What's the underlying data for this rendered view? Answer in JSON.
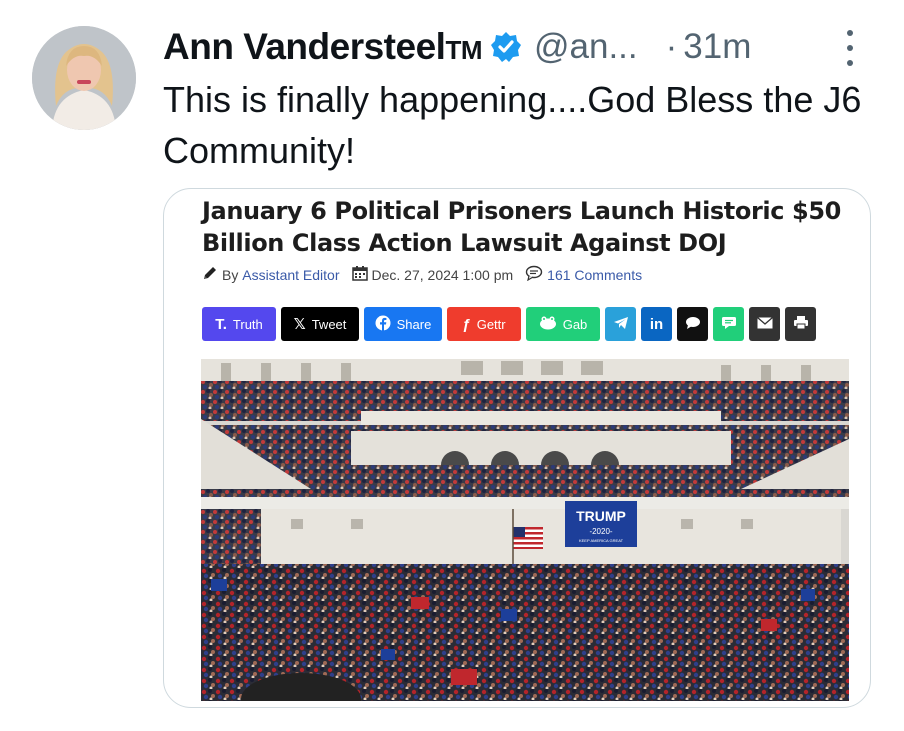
{
  "tweet": {
    "author_name": "Ann Vandersteel",
    "author_suffix": "TM",
    "handle": "@an...",
    "separator": "·",
    "time": "31m",
    "text": "This is finally happening....God Bless the J6 Community!"
  },
  "card": {
    "headline": "January 6 Political Prisoners Launch Historic $50 Billion Class Action Lawsuit Against DOJ",
    "by_label": "By",
    "author": "Assistant Editor",
    "date": "Dec. 27, 2024 1:00 pm",
    "comments": "161 Comments",
    "share_buttons": [
      {
        "label": "Truth",
        "icon": "truth-social-icon",
        "color": "#5448ee"
      },
      {
        "label": "Tweet",
        "icon": "x-icon",
        "color": "#000000"
      },
      {
        "label": "Share",
        "icon": "facebook-icon",
        "color": "#1877f2"
      },
      {
        "label": "Gettr",
        "icon": "gettr-icon",
        "color": "#ef3c2d"
      },
      {
        "label": "Gab",
        "icon": "gab-icon",
        "color": "#21cf7a"
      },
      {
        "label": "",
        "icon": "telegram-icon",
        "color": "#2aa1da"
      },
      {
        "label": "in",
        "icon": "linkedin-icon",
        "color": "#0a66c2"
      },
      {
        "label": "",
        "icon": "comment-bubble-icon",
        "color": "#111111"
      },
      {
        "label": "",
        "icon": "message-icon",
        "color": "#21cf7a"
      },
      {
        "label": "",
        "icon": "email-icon",
        "color": "#333333"
      },
      {
        "label": "",
        "icon": "print-icon",
        "color": "#333333"
      }
    ],
    "photo_banner": {
      "title": "TRUMP",
      "year": "-2020-",
      "slogan": "KEEP AMERICA GREAT"
    }
  },
  "colors": {
    "text": "#0f1419",
    "muted": "#536471",
    "verified": "#1d9bf0",
    "border": "#cfd9de",
    "author_link": "#3a5aa8"
  }
}
